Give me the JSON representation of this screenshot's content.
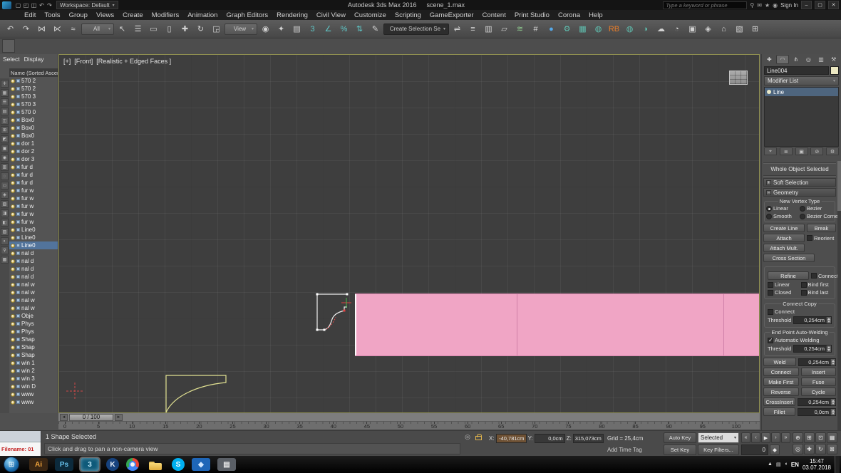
{
  "titlebar": {
    "quick_icons": [
      {
        "name": "new-file-icon",
        "glyph": "▢"
      },
      {
        "name": "open-file-icon",
        "glyph": "◰"
      },
      {
        "name": "save-file-icon",
        "glyph": "◫"
      },
      {
        "name": "undo-icon",
        "glyph": "↶"
      },
      {
        "name": "redo-icon",
        "glyph": "↷"
      }
    ],
    "workspace": "Workspace: Default",
    "app_title": "Autodesk 3ds Max 2016",
    "doc_title": "scene_1.max",
    "search_placeholder": "Type a keyword or phrase",
    "right_icons": [
      {
        "name": "search-icon",
        "glyph": "⚲"
      },
      {
        "name": "communication-center-icon",
        "glyph": "✉"
      },
      {
        "name": "favorites-icon",
        "glyph": "★"
      },
      {
        "name": "user-icon",
        "glyph": "◉"
      }
    ],
    "signin": "Sign In",
    "window_min": "–",
    "window_max": "▢",
    "window_close": "✕"
  },
  "menubar": [
    "Edit",
    "Tools",
    "Group",
    "Views",
    "Create",
    "Modifiers",
    "Animation",
    "Graph Editors",
    "Rendering",
    "Civil View",
    "Customize",
    "Scripting",
    "GameExporter",
    "Content",
    "Print Studio",
    "Corona",
    "Help"
  ],
  "toolbar": {
    "items": [
      {
        "name": "undo-icon",
        "glyph": "↶"
      },
      {
        "name": "redo-icon",
        "glyph": "↷"
      },
      {
        "name": "select-and-link-icon",
        "glyph": "⋈"
      },
      {
        "name": "unlink-selection-icon",
        "glyph": "⋉"
      },
      {
        "name": "bind-to-space-warp-icon",
        "glyph": "≈"
      },
      {
        "name": "selection-filter-dropdown",
        "label": "All",
        "type": "dd"
      },
      {
        "name": "select-object-icon",
        "glyph": "↖"
      },
      {
        "name": "select-by-name-icon",
        "glyph": "☰"
      },
      {
        "name": "rectangular-selection-icon",
        "glyph": "▭"
      },
      {
        "name": "window-crossing-icon",
        "glyph": "▯"
      },
      {
        "name": "select-and-move-icon",
        "glyph": "✚"
      },
      {
        "name": "select-and-rotate-icon",
        "glyph": "↻"
      },
      {
        "name": "select-and-scale-icon",
        "glyph": "◲"
      },
      {
        "name": "reference-coordinate-dropdown",
        "label": "View",
        "type": "dd"
      },
      {
        "name": "use-pivot-center-icon",
        "glyph": "◉"
      },
      {
        "name": "select-and-manipulate-icon",
        "glyph": "✦"
      },
      {
        "name": "keyboard-shortcut-override-icon",
        "glyph": "▤"
      },
      {
        "name": "snaps-toggle-icon",
        "glyph": "3",
        "color": "#5fc8c8"
      },
      {
        "name": "angle-snap-icon",
        "glyph": "∠",
        "color": "#5fc8c8"
      },
      {
        "name": "percent-snap-icon",
        "glyph": "%",
        "color": "#5fc8c8"
      },
      {
        "name": "spinner-snap-icon",
        "glyph": "⇅",
        "color": "#5fc8c8"
      },
      {
        "name": "edit-named-selection-icon",
        "glyph": "✎"
      },
      {
        "name": "named-selection-set-field",
        "label": "Create Selection Se",
        "type": "field"
      },
      {
        "name": "mirror-icon",
        "glyph": "⇌"
      },
      {
        "name": "align-icon",
        "glyph": "≡"
      },
      {
        "name": "layer-manager-icon",
        "glyph": "▥"
      },
      {
        "name": "graphite-ribbon-icon",
        "glyph": "▱"
      },
      {
        "name": "curve-editor-icon",
        "glyph": "≋",
        "color": "#8fc98f"
      },
      {
        "name": "schematic-view-icon",
        "glyph": "#"
      },
      {
        "name": "material-editor-icon",
        "glyph": "●",
        "color": "#55a8e8"
      },
      {
        "name": "render-setup-icon",
        "glyph": "⚙",
        "color": "#5fc0b0"
      },
      {
        "name": "rendered-frame-icon",
        "glyph": "▦",
        "color": "#5fc0b0"
      },
      {
        "name": "render-production-icon",
        "glyph": "◍",
        "color": "#5fc0b0"
      },
      {
        "name": "rb-render-icon",
        "glyph": "RB",
        "color": "#e87c28"
      },
      {
        "name": "iterative-render-icon",
        "glyph": "◍",
        "color": "#5fc0b0"
      },
      {
        "name": "activeshade-icon",
        "glyph": "◑",
        "color": "#5fc0b0"
      },
      {
        "name": "cloud-render-icon",
        "glyph": "☁"
      },
      {
        "name": "a360-gallery-icon",
        "glyph": "◔"
      },
      {
        "name": "composite-editor-icon",
        "glyph": "▣"
      },
      {
        "name": "scene-states-icon",
        "glyph": "◈"
      },
      {
        "name": "civil-view-icon",
        "glyph": "⌂"
      },
      {
        "name": "grab-viewport-icon",
        "glyph": "▧"
      },
      {
        "name": "misc-tool-icon",
        "glyph": "⊞"
      }
    ]
  },
  "explorer": {
    "tabs": [
      {
        "name": "explorer-tab-select",
        "label": "Select"
      },
      {
        "name": "explorer-tab-display",
        "label": "Display"
      }
    ],
    "header": "Name (Sorted Ascending)",
    "tools": [
      {
        "name": "lock-selection-icon",
        "glyph": "✛"
      },
      {
        "name": "pin-explorer-icon",
        "glyph": "▦"
      },
      {
        "name": "sync-selection-icon",
        "glyph": "☰"
      },
      {
        "name": "select-none-icon",
        "glyph": "▤"
      },
      {
        "name": "select-invert-icon",
        "glyph": "◫"
      },
      {
        "name": "expand-all-icon",
        "glyph": "⊞"
      },
      {
        "name": "collapse-all-icon",
        "glyph": "◩"
      },
      {
        "name": "filter-geometry-icon",
        "glyph": "▣"
      },
      {
        "name": "filter-shapes-icon",
        "glyph": "◉"
      },
      {
        "name": "filter-lights-icon",
        "glyph": "▥"
      },
      {
        "name": "filter-cameras-icon",
        "glyph": "◌"
      },
      {
        "name": "filter-helpers-icon",
        "glyph": "▭"
      },
      {
        "name": "filter-spacewarps-icon",
        "glyph": "◈"
      },
      {
        "name": "sort-alphabetical-icon",
        "glyph": "▧"
      },
      {
        "name": "sort-by-type-icon",
        "glyph": "◨"
      },
      {
        "name": "new-container-icon",
        "glyph": "◧"
      },
      {
        "name": "delete-object-icon",
        "glyph": "▨"
      },
      {
        "name": "object-properties-icon",
        "glyph": "◐"
      },
      {
        "name": "find-object-icon",
        "glyph": "⚲"
      },
      {
        "name": "explorer-settings-icon",
        "glyph": "▩"
      }
    ],
    "items": [
      {
        "label": "570 2"
      },
      {
        "label": "570 2"
      },
      {
        "label": "570 3"
      },
      {
        "label": "570 3"
      },
      {
        "label": "570 0"
      },
      {
        "label": "Box0"
      },
      {
        "label": "Box0"
      },
      {
        "label": "Box0"
      },
      {
        "label": "dor 1"
      },
      {
        "label": "dor 2"
      },
      {
        "label": "dor 3"
      },
      {
        "label": "fur d"
      },
      {
        "label": "fur d"
      },
      {
        "label": "fur d"
      },
      {
        "label": "fur w"
      },
      {
        "label": "fur w"
      },
      {
        "label": "fur w"
      },
      {
        "label": "fur w"
      },
      {
        "label": "fur w"
      },
      {
        "label": "Line0"
      },
      {
        "label": "Line0"
      },
      {
        "label": "Line0",
        "selected": true
      },
      {
        "label": "nal d"
      },
      {
        "label": "nal d"
      },
      {
        "label": "nal d"
      },
      {
        "label": "nal d"
      },
      {
        "label": "nal w"
      },
      {
        "label": "nal w"
      },
      {
        "label": "nal w"
      },
      {
        "label": "nal w"
      },
      {
        "label": "Obje"
      },
      {
        "label": "Phys"
      },
      {
        "label": "Phys"
      },
      {
        "label": "Shap"
      },
      {
        "label": "Shap"
      },
      {
        "label": "Shap"
      },
      {
        "label": "win 1"
      },
      {
        "label": "win 2"
      },
      {
        "label": "win 3"
      },
      {
        "label": "win D"
      },
      {
        "label": "www"
      },
      {
        "label": "www"
      }
    ]
  },
  "viewport": {
    "menu_general": "[+]",
    "menu_pov": "[Front]",
    "menu_shading": "[Realistic + Edged Faces ]"
  },
  "command_panel": {
    "tabs": [
      {
        "name": "create-tab",
        "glyph": "✚"
      },
      {
        "name": "modify-tab",
        "glyph": "◠",
        "selected": true
      },
      {
        "name": "hierarchy-tab",
        "glyph": "⋔"
      },
      {
        "name": "motion-tab",
        "glyph": "◎"
      },
      {
        "name": "display-tab",
        "glyph": "▥"
      },
      {
        "name": "utilities-tab",
        "glyph": "⚒"
      }
    ],
    "object_name": "Line004",
    "modifier_list": "Modifier List",
    "stack": [
      {
        "label": "Line",
        "selected": true
      }
    ],
    "stack_tools": [
      {
        "name": "pin-stack-icon",
        "glyph": "⌖"
      },
      {
        "name": "show-end-result-icon",
        "glyph": "≣"
      },
      {
        "name": "make-unique-icon",
        "glyph": "▣"
      },
      {
        "name": "remove-modifier-icon",
        "glyph": "⊘"
      },
      {
        "name": "configure-modifier-sets-icon",
        "glyph": "⚙"
      }
    ],
    "selection_status": "Whole Object Selected",
    "soft_selection": "Soft Selection",
    "geometry_title": "Geometry",
    "new_vertex_type": {
      "title": "New Vertex Type",
      "options": [
        {
          "label": "Linear",
          "checked": true
        },
        {
          "label": "Bezier"
        },
        {
          "label": "Smooth"
        },
        {
          "label": "Bezier Corner"
        }
      ]
    },
    "geometry": {
      "create_line": "Create Line",
      "break": "Break",
      "attach": "Attach",
      "reorient": "Reorient",
      "attach_mult": "Attach Mult.",
      "cross_section": "Cross Section",
      "refine": "Refine",
      "connect_cb": "Connect",
      "linear_cb": "Linear",
      "bind_first": "Bind first",
      "closed_cb": "Closed",
      "bind_last": "Bind last",
      "connect_copy_title": "Connect Copy",
      "connect_copy_cb": "Connect",
      "threshold_label": "Threshold",
      "threshold_value": "0,254cm",
      "end_point_title": "End Point Auto-Welding",
      "auto_weld_cb": "Automatic Welding",
      "auto_weld_checked": true,
      "threshold2_label": "Threshold",
      "threshold2_value": "0,254cm",
      "weld": "Weld",
      "weld_value": "0,254cm",
      "connect_btn": "Connect",
      "insert": "Insert",
      "make_first": "Make First",
      "fuse": "Fuse",
      "reverse": "Reverse",
      "cycle": "Cycle",
      "crossinsert": "CrossInsert",
      "crossinsert_value": "0,254cm",
      "fillet": "Fillet",
      "fillet_value": "0,0cm"
    }
  },
  "timeline": {
    "prev_icon": "◄",
    "next_icon": "►",
    "slider_value": "0 / 100",
    "ticks": [
      "0",
      "5",
      "10",
      "15",
      "20",
      "25",
      "30",
      "35",
      "40",
      "45",
      "50",
      "55",
      "60",
      "65",
      "70",
      "75",
      "80",
      "85",
      "90",
      "95",
      "100"
    ]
  },
  "statusbar": {
    "filename_overlay": "Filename: 01",
    "shape_selected": "1 Shape Selected",
    "prompt": "Click and drag to pan a non-camera view",
    "isolate_icon": "◎",
    "x_label": "X:",
    "x_value": "-40,781cm",
    "y_label": "Y:",
    "y_value": "0,0cm",
    "z_label": "Z:",
    "z_value": "315,073cm",
    "grid": "Grid = 25,4cm",
    "add_time_tag": "Add Time Tag",
    "auto_key": "Auto Key",
    "selected_dd": "Selected",
    "set_key": "Set Key",
    "key_filters": "Key Filters...",
    "frame": "0",
    "keymode_icon": "◆",
    "transport": [
      {
        "name": "go-to-start-button",
        "glyph": "«"
      },
      {
        "name": "previous-frame-button",
        "glyph": "‹"
      },
      {
        "name": "play-button",
        "glyph": "▶"
      },
      {
        "name": "next-frame-button",
        "glyph": "›"
      },
      {
        "name": "go-to-end-button",
        "glyph": "»"
      }
    ],
    "nav": [
      {
        "name": "zoom-icon",
        "glyph": "⊕"
      },
      {
        "name": "zoom-all-icon",
        "glyph": "⊞"
      },
      {
        "name": "zoom-extents-icon",
        "glyph": "⊡"
      },
      {
        "name": "zoom-extents-all-icon",
        "glyph": "▦"
      },
      {
        "name": "zoom-region-icon",
        "glyph": "◎"
      },
      {
        "name": "pan-view-icon",
        "glyph": "✚"
      },
      {
        "name": "orbit-icon",
        "glyph": "↻"
      },
      {
        "name": "maximize-viewport-icon",
        "glyph": "⊠"
      }
    ]
  },
  "taskbar": {
    "start_icon": "⊞",
    "apps": [
      {
        "name": "taskbar-illustrator",
        "label": "Ai",
        "bg": "#3a2613",
        "color": "#f0a43c"
      },
      {
        "name": "taskbar-photoshop",
        "label": "Ps",
        "bg": "#0c2a3c",
        "color": "#6ac6f2"
      },
      {
        "name": "taskbar-3dsmax",
        "label": "3",
        "bg": "#0e5a7a",
        "color": "#bfe8f8",
        "selected": true
      },
      {
        "name": "taskbar-kmplayer",
        "label": "K",
        "bg": "#16427e",
        "color": "#eef4fa",
        "type": "round"
      },
      {
        "name": "taskbar-chrome",
        "type": "chrome"
      },
      {
        "name": "taskbar-explorer",
        "type": "folder"
      },
      {
        "name": "taskbar-skype",
        "label": "S",
        "bg": "#00aff0",
        "color": "#ffffff",
        "type": "round"
      },
      {
        "name": "taskbar-app-blue",
        "label": "◆",
        "bg": "#1e66b8",
        "color": "#cfe6ff"
      },
      {
        "name": "taskbar-notepad",
        "label": "▤",
        "bg": "#5a5f66",
        "color": "#e8e8e8"
      }
    ],
    "tray_icons": [
      {
        "name": "show-hidden-icons",
        "glyph": "▲"
      },
      {
        "name": "network-status-icon",
        "glyph": "▤"
      },
      {
        "name": "volume-icon",
        "glyph": "◖"
      }
    ],
    "language": "EN",
    "time": "15:47",
    "date": "03.07.2018"
  }
}
